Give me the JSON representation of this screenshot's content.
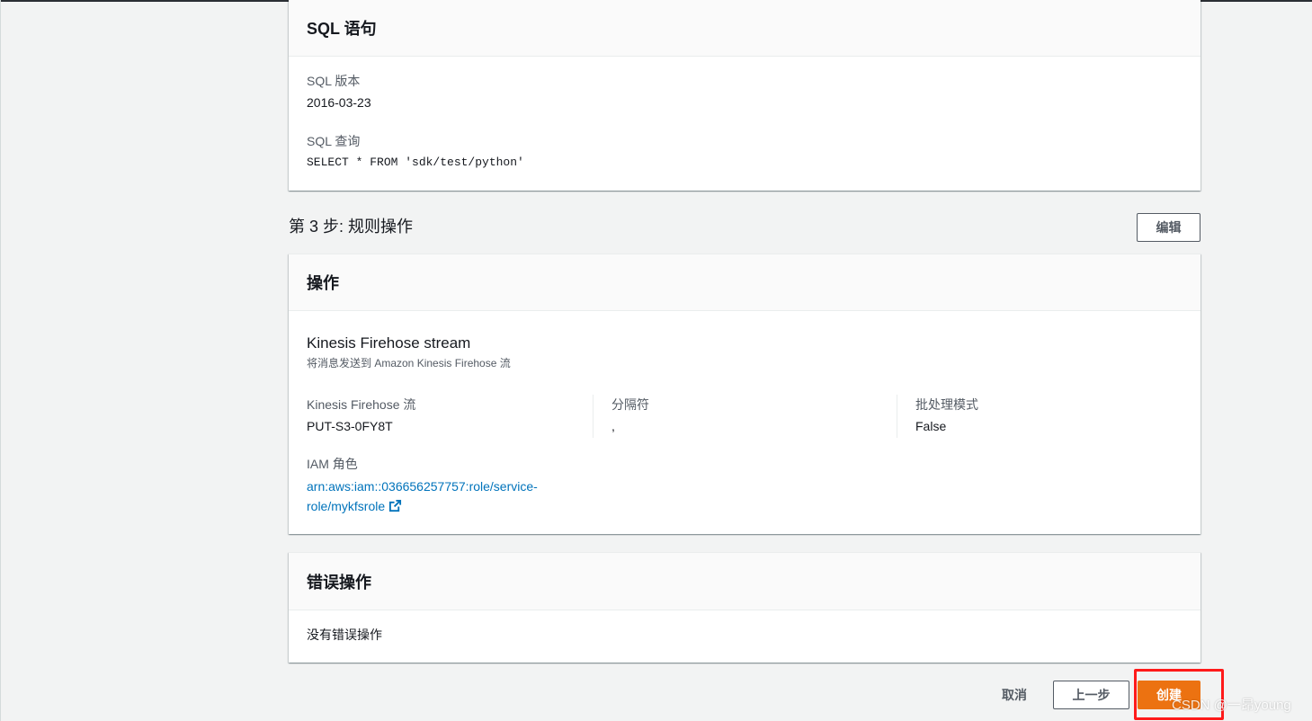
{
  "sql_panel": {
    "title": "SQL 语句",
    "version_label": "SQL 版本",
    "version_value": "2016-03-23",
    "query_label": "SQL 查询",
    "query_value": "SELECT * FROM 'sdk/test/python'"
  },
  "step3": {
    "title": "第 3 步: 规则操作",
    "edit_label": "编辑"
  },
  "actions_panel": {
    "title": "操作",
    "action_name": "Kinesis Firehose stream",
    "action_desc": "将消息发送到 Amazon Kinesis Firehose 流",
    "stream_label": "Kinesis Firehose 流",
    "stream_value": "PUT-S3-0FY8T",
    "separator_label": "分隔符",
    "separator_value": ",",
    "batch_label": "批处理模式",
    "batch_value": "False",
    "iam_label": "IAM 角色",
    "iam_line1": "arn:aws:iam::036656257757:role/service-",
    "iam_line2": "role/mykfsrole"
  },
  "error_panel": {
    "title": "错误操作",
    "body": "没有错误操作"
  },
  "footer": {
    "cancel_label": "取消",
    "prev_label": "上一步",
    "create_label": "创建"
  },
  "watermark": "CSDN @一昂young",
  "colors": {
    "primary": "#ec7211",
    "link": "#0073bb",
    "highlight": "#ff1a1a"
  },
  "icons": {
    "external_link": "external-link-icon"
  }
}
